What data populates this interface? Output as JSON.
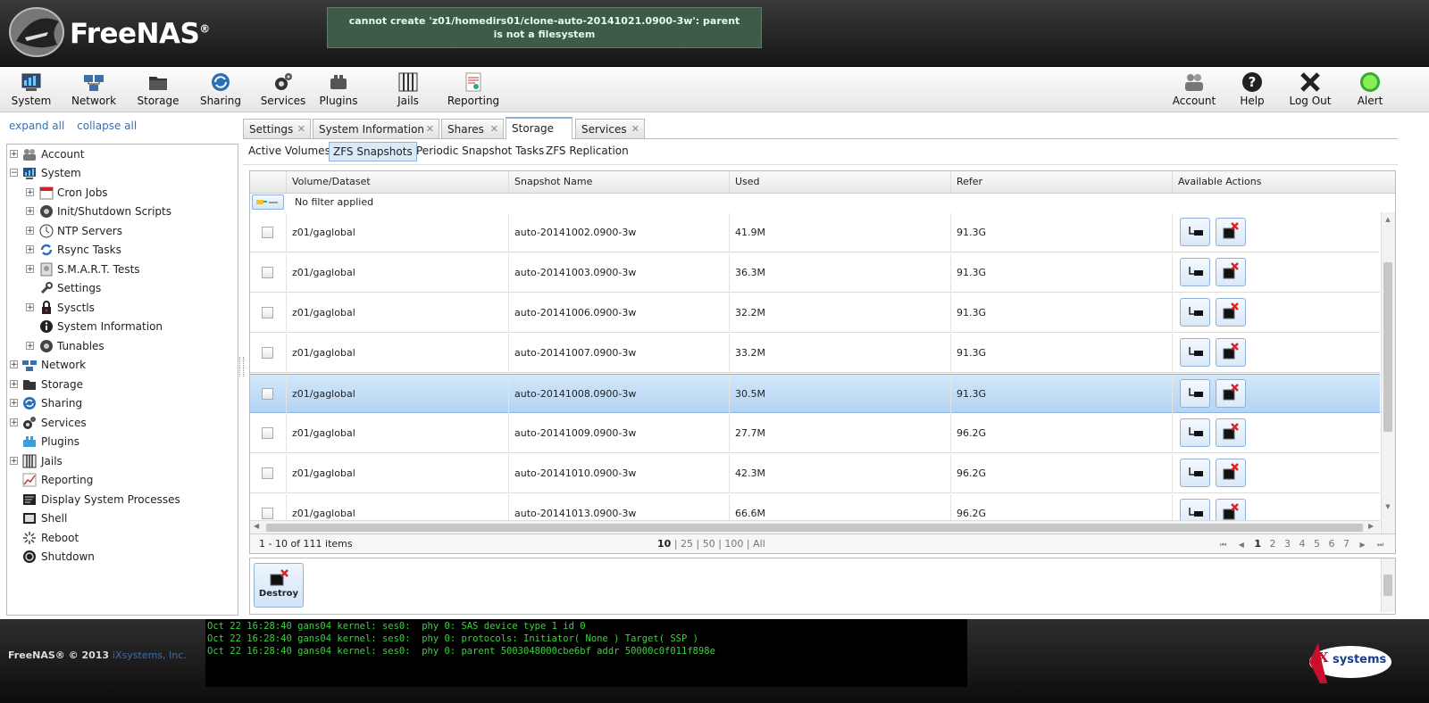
{
  "app": {
    "name": "FreeNAS",
    "trademark": "®"
  },
  "flash_message": "cannot create 'z01/homedirs01/clone-auto-20141021.0900-3w': parent is not a filesystem",
  "toolbar": {
    "left": [
      {
        "label": "System",
        "icon": "system-icon"
      },
      {
        "label": "Network",
        "icon": "network-icon"
      },
      {
        "label": "Storage",
        "icon": "storage-icon"
      },
      {
        "label": "Sharing",
        "icon": "sharing-icon"
      },
      {
        "label": "Services",
        "icon": "services-icon"
      },
      {
        "label": "Plugins",
        "icon": "plugins-icon"
      },
      {
        "label": "Jails",
        "icon": "jails-icon"
      },
      {
        "label": "Reporting",
        "icon": "reporting-icon"
      }
    ],
    "right": [
      {
        "label": "Account",
        "icon": "account-icon"
      },
      {
        "label": "Help",
        "icon": "help-icon"
      },
      {
        "label": "Log Out",
        "icon": "logout-icon"
      },
      {
        "label": "Alert",
        "icon": "alert-icon"
      }
    ]
  },
  "sidebar": {
    "expand_all": "expand all",
    "collapse_all": "collapse all",
    "tree": [
      {
        "label": "Account",
        "icon": "account-icon",
        "toggle": "+"
      },
      {
        "label": "System",
        "icon": "system-icon",
        "toggle": "−"
      },
      {
        "label": "Cron Jobs",
        "icon": "calendar-icon",
        "toggle": "+"
      },
      {
        "label": "Init/Shutdown Scripts",
        "icon": "gear-icon",
        "toggle": "+"
      },
      {
        "label": "NTP Servers",
        "icon": "clock-icon",
        "toggle": "+"
      },
      {
        "label": "Rsync Tasks",
        "icon": "sync-icon",
        "toggle": "+"
      },
      {
        "label": "S.M.A.R.T. Tests",
        "icon": "disk-icon",
        "toggle": "+"
      },
      {
        "label": "Settings",
        "icon": "wrench-icon",
        "toggle": ""
      },
      {
        "label": "Sysctls",
        "icon": "lock-icon",
        "toggle": "+"
      },
      {
        "label": "System Information",
        "icon": "info-icon",
        "toggle": ""
      },
      {
        "label": "Tunables",
        "icon": "gear-icon",
        "toggle": "+"
      },
      {
        "label": "Network",
        "icon": "network-icon",
        "toggle": "+"
      },
      {
        "label": "Storage",
        "icon": "storage-icon",
        "toggle": "+"
      },
      {
        "label": "Sharing",
        "icon": "sharing-icon",
        "toggle": "+"
      },
      {
        "label": "Services",
        "icon": "services-icon",
        "toggle": "+"
      },
      {
        "label": "Plugins",
        "icon": "plugins-icon",
        "toggle": ""
      },
      {
        "label": "Jails",
        "icon": "jails-icon",
        "toggle": "+"
      },
      {
        "label": "Reporting",
        "icon": "reporting-icon",
        "toggle": ""
      },
      {
        "label": "Display System Processes",
        "icon": "processes-icon",
        "toggle": ""
      },
      {
        "label": "Shell",
        "icon": "shell-icon",
        "toggle": ""
      },
      {
        "label": "Reboot",
        "icon": "reboot-icon",
        "toggle": ""
      },
      {
        "label": "Shutdown",
        "icon": "shutdown-icon",
        "toggle": ""
      }
    ]
  },
  "tabs": [
    {
      "label": "Settings",
      "active": false
    },
    {
      "label": "System Information",
      "active": false
    },
    {
      "label": "Shares",
      "active": false
    },
    {
      "label": "Storage",
      "active": true
    },
    {
      "label": "Services",
      "active": false
    }
  ],
  "subtabs": [
    {
      "label": "Active Volumes",
      "active": false
    },
    {
      "label": "ZFS Snapshots",
      "active": true
    },
    {
      "label": "Periodic Snapshot Tasks",
      "active": false
    },
    {
      "label": "ZFS Replication",
      "active": false
    }
  ],
  "grid": {
    "columns": [
      "Volume/Dataset",
      "Snapshot Name",
      "Used",
      "Refer",
      "Available Actions"
    ],
    "filter_text": "No filter applied",
    "rows": [
      {
        "dataset": "z01/gaglobal",
        "snapshot": "auto-20141002.0900-3w",
        "used": "41.9M",
        "refer": "91.3G",
        "selected": false
      },
      {
        "dataset": "z01/gaglobal",
        "snapshot": "auto-20141003.0900-3w",
        "used": "36.3M",
        "refer": "91.3G",
        "selected": false
      },
      {
        "dataset": "z01/gaglobal",
        "snapshot": "auto-20141006.0900-3w",
        "used": "32.2M",
        "refer": "91.3G",
        "selected": false
      },
      {
        "dataset": "z01/gaglobal",
        "snapshot": "auto-20141007.0900-3w",
        "used": "33.2M",
        "refer": "91.3G",
        "selected": false
      },
      {
        "dataset": "z01/gaglobal",
        "snapshot": "auto-20141008.0900-3w",
        "used": "30.5M",
        "refer": "91.3G",
        "selected": true
      },
      {
        "dataset": "z01/gaglobal",
        "snapshot": "auto-20141009.0900-3w",
        "used": "27.7M",
        "refer": "96.2G",
        "selected": false
      },
      {
        "dataset": "z01/gaglobal",
        "snapshot": "auto-20141010.0900-3w",
        "used": "42.3M",
        "refer": "96.2G",
        "selected": false
      },
      {
        "dataset": "z01/gaglobal",
        "snapshot": "auto-20141013.0900-3w",
        "used": "66.6M",
        "refer": "96.2G",
        "selected": false
      }
    ],
    "summary": "1 - 10 of 111 items",
    "page_sizes": [
      "10",
      "25",
      "50",
      "100",
      "All"
    ],
    "pages": [
      "1",
      "2",
      "3",
      "4",
      "5",
      "6",
      "7"
    ],
    "current_page": "1"
  },
  "actions": {
    "destroy_label": "Destroy"
  },
  "footer": {
    "copyright": "FreeNAS® © 2013",
    "company_link": "iXsystems, Inc.",
    "console_lines": [
      "Oct 22 16:28:40 gans04 kernel: ses0:  phy 0: SAS device type 1 id 0",
      "Oct 22 16:28:40 gans04 kernel: ses0:  phy 0: protocols: Initiator( None ) Target( SSP )",
      "Oct 22 16:28:40 gans04 kernel: ses0:  phy 0: parent 5003048000cbe6bf addr 50000c0f011f898e"
    ],
    "brand": "systems",
    "brand_prefix": "iX"
  }
}
